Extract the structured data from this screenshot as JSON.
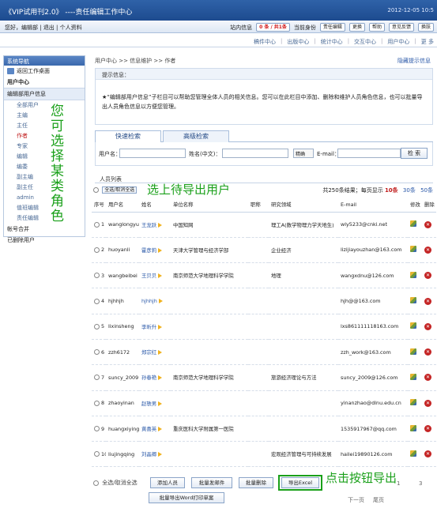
{
  "header": {
    "app_title": "《VIP试用刊2.0》 ----责任编辑工作中心",
    "date": "2012-12-05 10:5"
  },
  "userbar": {
    "greeting": "您好，编辑部",
    "logout": "退出",
    "profile": "个人资料",
    "messages_label": "站内信息",
    "messages_count": "0 条 / 共1条",
    "current_role_label": "当前身份",
    "current_role": "责任编辑",
    "change": "更换",
    "help": "帮助",
    "feedback": "意见反馈",
    "switch": "换肤"
  },
  "topnav": [
    "稿件中心",
    "出版中心",
    "统计中心",
    "交互中心",
    "用户中心",
    "更 多"
  ],
  "sidebar": {
    "header": "系统导航",
    "home": "返回工作桌面",
    "user_center": "用户中心",
    "group": "编辑部用户信息",
    "roles": [
      "全部用户",
      "主编",
      "主任",
      "作者",
      "专家",
      "编辑",
      "编委",
      "副主编",
      "副主任",
      "admin",
      "值班编辑",
      "责任编辑"
    ],
    "active_role": "作者",
    "account_merge": "帐号合并",
    "deleted_users": "已删除用户"
  },
  "annotations": {
    "choose_role": "您可选择某类角色",
    "select_users": "选上待导出用户",
    "click_export": "点击按钮导出"
  },
  "breadcrumb": "用户中心 >> 信息维护 >> 作者",
  "hide_tip": "隐藏提示信息",
  "tip": {
    "title": "提示信息：",
    "text": "★“编辑部用户信息”子栏目可以帮助您管理全体人员的相关信息。您可以在此栏目中添加、删除和维护人员角色信息，也可以批量导出人员角色信息以方便您管理。"
  },
  "search": {
    "tab_quick": "快速检索",
    "tab_advanced": "高级检索",
    "username_label": "用户名：",
    "name_label": "姓名(中文)：",
    "match_option": "精确",
    "email_label": "E-mail：",
    "button": "检 索"
  },
  "list": {
    "title": "人员列表",
    "select_all": "全选/取消全选",
    "summary": "共250条结果；每页显示",
    "page_size_selected": "10条",
    "page_size_options": [
      "30条",
      "50条"
    ]
  },
  "columns": [
    "序号",
    "用户名",
    "姓名",
    "单位名称",
    "职称",
    "研究领域",
    "E-mail",
    "修改",
    "删除"
  ],
  "rows": [
    {
      "no": "1",
      "username": "wanglongyue",
      "name": "王龙跃",
      "unit": "中国知网",
      "title": "",
      "field": "理工A(数学物理力学天地生)",
      "email": "wly5233@cnki.net"
    },
    {
      "no": "2",
      "username": "huoyanli",
      "name": "霍彦莉",
      "unit": "天津大学管理与经济学部",
      "title": "",
      "field": "企业经济",
      "email": "lizijiayouzhan@163.com"
    },
    {
      "no": "3",
      "username": "wangbeibei",
      "name": "王贝贝",
      "unit": "南京师范大学地理科学学院",
      "title": "",
      "field": "地理",
      "email": "wangxdnu@126.com"
    },
    {
      "no": "4",
      "username": "hjhhjh",
      "name": "hjhhjh",
      "unit": "",
      "title": "",
      "field": "",
      "email": "hjh@@163.com"
    },
    {
      "no": "5",
      "username": "lixinsheng",
      "name": "李昕升",
      "unit": "",
      "title": "",
      "field": "",
      "email": "lxs861111118163.com"
    },
    {
      "no": "6",
      "username": "zzh6172",
      "name": "郑宗红",
      "unit": "",
      "title": "",
      "field": "",
      "email": "zzh_work@163.com"
    },
    {
      "no": "7",
      "username": "suncy_2009",
      "name": "孙春艳",
      "unit": "南京师范大学地理科学学院",
      "title": "",
      "field": "旅游经济理论与方法",
      "email": "suncy_2009@126.com"
    },
    {
      "no": "8",
      "username": "zhaoyinan",
      "name": "赵轶男",
      "unit": "",
      "title": "",
      "field": "",
      "email": "yinanzhao@dlnu.edu.cn"
    },
    {
      "no": "9",
      "username": "huangxiying",
      "name": "黄喜英",
      "unit": "重庆医科大学附属第一医院",
      "title": "",
      "field": "",
      "email": "1535917967@qq.com"
    },
    {
      "no": "10",
      "username": "liujingqing",
      "name": "刘晶卿",
      "unit": "",
      "title": "",
      "field": "宏观经济管理与可持续发展",
      "email": "hailei19890126.com"
    }
  ],
  "bottom": {
    "select_all": "全选/取消全选",
    "add": "添加人员",
    "mail": "批量发邮件",
    "delete": "批量删除",
    "export": "导出Excel",
    "export_word": "批量导出Word打印单案",
    "pages": [
      "1",
      "3"
    ],
    "next": "下一页",
    "last": "尾页"
  }
}
